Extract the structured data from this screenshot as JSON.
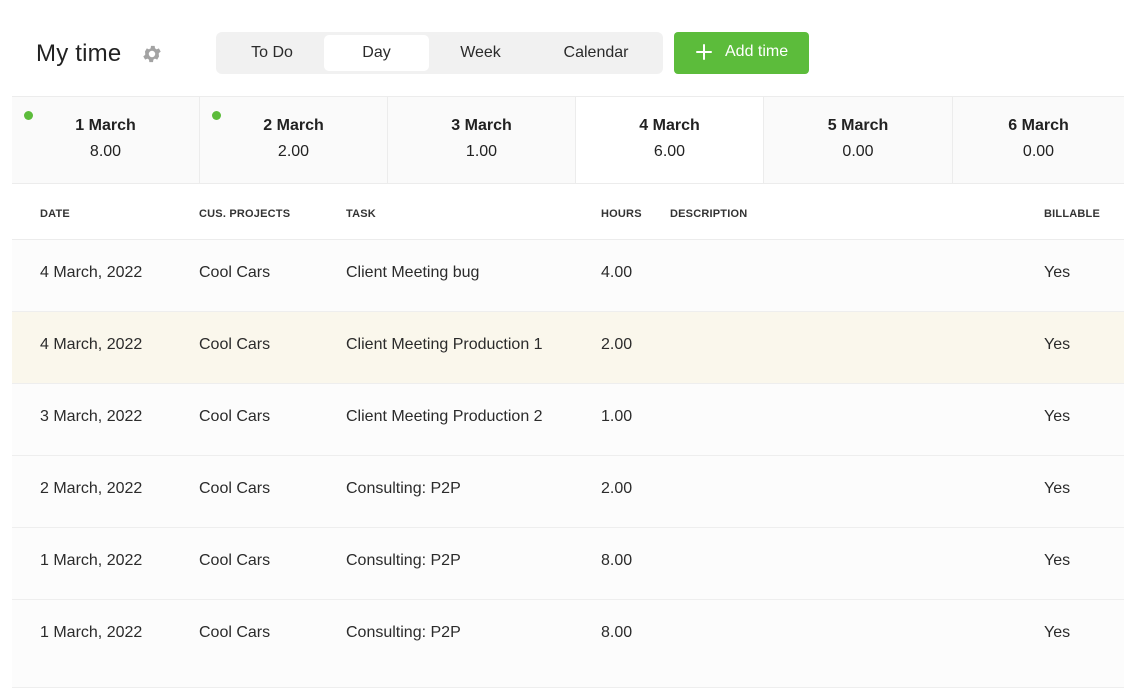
{
  "header": {
    "title": "My time",
    "settings_icon": "gear-icon"
  },
  "view_tabs": [
    {
      "label": "To Do",
      "active": false
    },
    {
      "label": "Day",
      "active": true
    },
    {
      "label": "Week",
      "active": false
    },
    {
      "label": "Calendar",
      "active": false
    }
  ],
  "add_button": {
    "label": "Add time",
    "icon": "plus-icon",
    "color": "#5cbc3b"
  },
  "days": [
    {
      "label": "1 March",
      "hours": "8.00",
      "indicator": true,
      "current": false
    },
    {
      "label": "2 March",
      "hours": "2.00",
      "indicator": true,
      "current": false
    },
    {
      "label": "3 March",
      "hours": "1.00",
      "indicator": false,
      "current": false
    },
    {
      "label": "4 March",
      "hours": "6.00",
      "indicator": false,
      "current": true
    },
    {
      "label": "5 March",
      "hours": "0.00",
      "indicator": false,
      "current": false
    },
    {
      "label": "6 March",
      "hours": "0.00",
      "indicator": false,
      "current": false
    }
  ],
  "table": {
    "columns": {
      "date": "DATE",
      "projects": "CUS. PROJECTS",
      "task": "TASK",
      "hours": "HOURS",
      "description": "DESCRIPTION",
      "billable": "BILLABLE"
    },
    "rows": [
      {
        "date": "4 March, 2022",
        "project": "Cool Cars",
        "task": "Client Meeting bug",
        "hours": "4.00",
        "description": "",
        "billable": "Yes",
        "highlighted": false
      },
      {
        "date": "4 March, 2022",
        "project": "Cool Cars",
        "task": "Client Meeting Production 1",
        "hours": "2.00",
        "description": "",
        "billable": "Yes",
        "highlighted": true
      },
      {
        "date": "3 March, 2022",
        "project": "Cool Cars",
        "task": "Client Meeting Production 2",
        "hours": "1.00",
        "description": "",
        "billable": "Yes",
        "highlighted": false
      },
      {
        "date": "2 March, 2022",
        "project": "Cool Cars",
        "task": "Consulting: P2P",
        "hours": "2.00",
        "description": "",
        "billable": "Yes",
        "highlighted": false
      },
      {
        "date": "1 March, 2022",
        "project": "Cool Cars",
        "task": "Consulting: P2P",
        "hours": "8.00",
        "description": "",
        "billable": "Yes",
        "highlighted": false
      },
      {
        "date": "1 March, 2022",
        "project": "Cool Cars",
        "task": "Consulting: P2P",
        "hours": "8.00",
        "description": "",
        "billable": "Yes",
        "highlighted": false
      }
    ]
  },
  "colors": {
    "accent": "#5cbc3b",
    "highlight_row": "#faf7ec"
  }
}
